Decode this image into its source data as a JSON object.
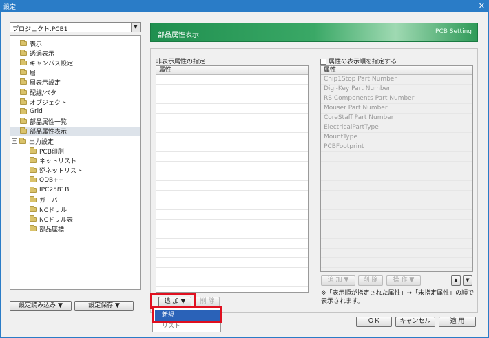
{
  "window": {
    "title": "設定",
    "close_glyph": "✕"
  },
  "project_select": {
    "value": "プロジェクト.PCB1",
    "arrow": "▼"
  },
  "tree": {
    "items": [
      {
        "label": "表示",
        "level": 0
      },
      {
        "label": "透過表示",
        "level": 0
      },
      {
        "label": "キャンバス設定",
        "level": 0
      },
      {
        "label": "層",
        "level": 0
      },
      {
        "label": "層表示設定",
        "level": 0
      },
      {
        "label": "配線/ベタ",
        "level": 0
      },
      {
        "label": "オブジェクト",
        "level": 0
      },
      {
        "label": "Grid",
        "level": 0
      },
      {
        "label": "部品属性一覧",
        "level": 0
      },
      {
        "label": "部品属性表示",
        "level": 0,
        "selected": true
      },
      {
        "label": "出力設定",
        "level": 0,
        "expander": "−"
      },
      {
        "label": "PCB印刷",
        "level": 1
      },
      {
        "label": "ネットリスト",
        "level": 1
      },
      {
        "label": "逆ネットリスト",
        "level": 1
      },
      {
        "label": "ODB++",
        "level": 1
      },
      {
        "label": "IPC2581B",
        "level": 1
      },
      {
        "label": "ガーバー",
        "level": 1
      },
      {
        "label": "NCドリル",
        "level": 1
      },
      {
        "label": "NCドリル表",
        "level": 1
      },
      {
        "label": "部品座標",
        "level": 1
      }
    ]
  },
  "bottom_left": {
    "load_label": "設定読み込み ▼",
    "save_label": "設定保存 ▼"
  },
  "banner": {
    "title": "部品属性表示",
    "subtitle": "PCB Setting"
  },
  "left_panel": {
    "title": "非表示属性の指定",
    "header": "属性",
    "add_label": "追 加 ▼",
    "delete_label": "削 除"
  },
  "right_panel": {
    "checkbox_label": "属性の表示順を指定する",
    "header": "属性",
    "rows": [
      "Chip1Stop Part Number",
      "Digi-Key Part Number",
      "RS Components Part Number",
      "Mouser Part Number",
      "CoreStaff Part Number",
      "ElectricalPartType",
      "MountType",
      "PCBFootprint"
    ],
    "add_label": "追 加 ▼",
    "delete_label": "削 除",
    "ops_label": "操 作 ▼",
    "up_glyph": "▲",
    "down_glyph": "▼",
    "note": "※「表示順が指定された属性」→「未指定属性」の順で表示されます。"
  },
  "dropdown": {
    "items": [
      "新規",
      "リスト"
    ]
  },
  "dialog_buttons": {
    "ok": "ＯＫ",
    "cancel": "キャンセル",
    "apply": "適 用"
  },
  "colors": {
    "titlebar": "#2a7cc7",
    "banner": "#2f9a58",
    "highlight": "#e01020",
    "menu_selected": "#2a62b8"
  }
}
